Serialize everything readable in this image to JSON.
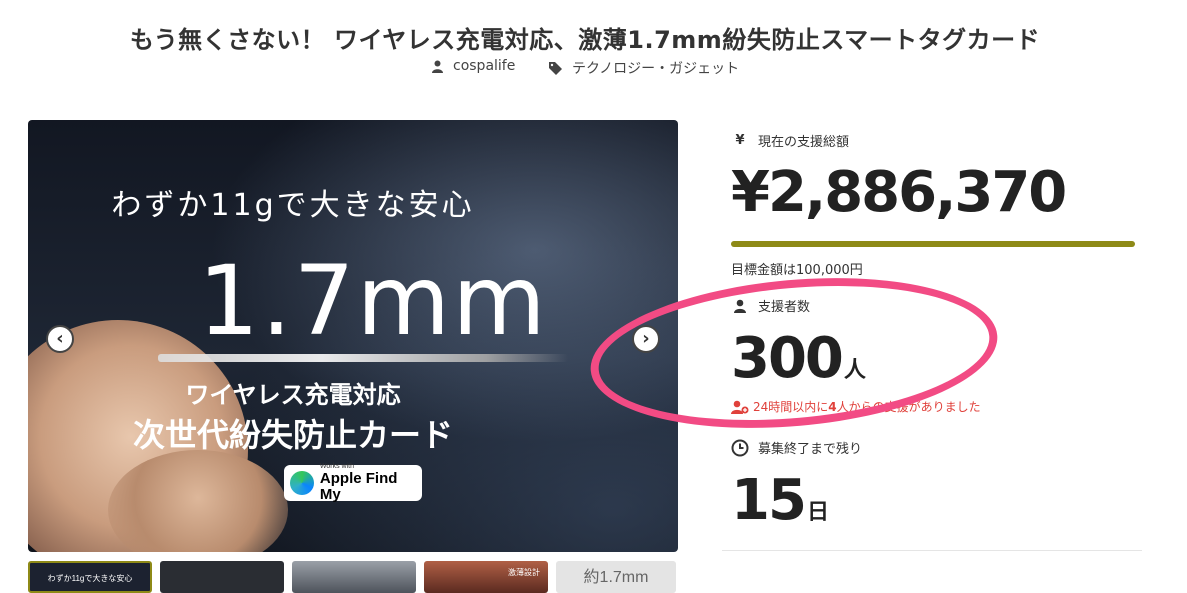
{
  "title": "もう無くさない！ ワイヤレス充電対応、激薄1.7mm紛失防止スマートタグカード",
  "meta": {
    "author": "cospalife",
    "category": "テクノロジー・ガジェット"
  },
  "hero": {
    "line1": "わずか11gで大きな安心",
    "line2": "1.7mm",
    "line3": "ワイヤレス充電対応",
    "line4": "次世代紛失防止カード",
    "badge_small": "Works with",
    "badge_big": "Apple Find My",
    "prev": "‹",
    "next": "›"
  },
  "thumbnails": [
    {
      "label": "わずか11gで大きな安心",
      "color": "#1c2230"
    },
    {
      "label": "",
      "color": "#2a2d33"
    },
    {
      "label": "",
      "color": "#6f7480"
    },
    {
      "label": "激薄設計",
      "color": "#7a3a2e"
    },
    {
      "label": "約1.7mm",
      "color": "#d9d9d9"
    }
  ],
  "stats": {
    "total": {
      "label": "現在の支援総額",
      "icon": "¥",
      "value": "¥2,886,370"
    },
    "progress": {
      "percent": 100,
      "color": "#8e8a17"
    },
    "goal": "目標金額は100,000円",
    "supporters": {
      "label": "支援者数",
      "value": "300",
      "unit": "人"
    },
    "recent": {
      "prefix": "24時間以内に",
      "count": "4",
      "suffix": "人からの支援がありました"
    },
    "remaining": {
      "label": "募集終了まで残り",
      "value": "15",
      "unit": "日"
    }
  },
  "colors": {
    "accent": "#8e8a17",
    "alert": "#e0413b",
    "highlight": "#f24b84"
  }
}
